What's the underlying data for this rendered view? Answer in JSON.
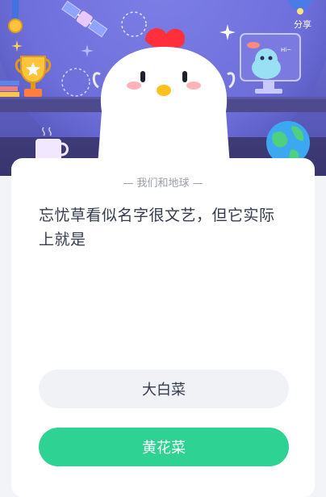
{
  "header": {
    "share_label": "分享"
  },
  "quiz": {
    "category": "— 我们和地球 —",
    "question": "忘忧草看似名字很文艺，但它实际上就是",
    "options": [
      {
        "label": "大白菜"
      },
      {
        "label": "黄花菜"
      }
    ]
  },
  "colors": {
    "accent_green": "#2ed393",
    "hero_purple": "#6e6fd6",
    "text_dark": "#333b4d"
  }
}
